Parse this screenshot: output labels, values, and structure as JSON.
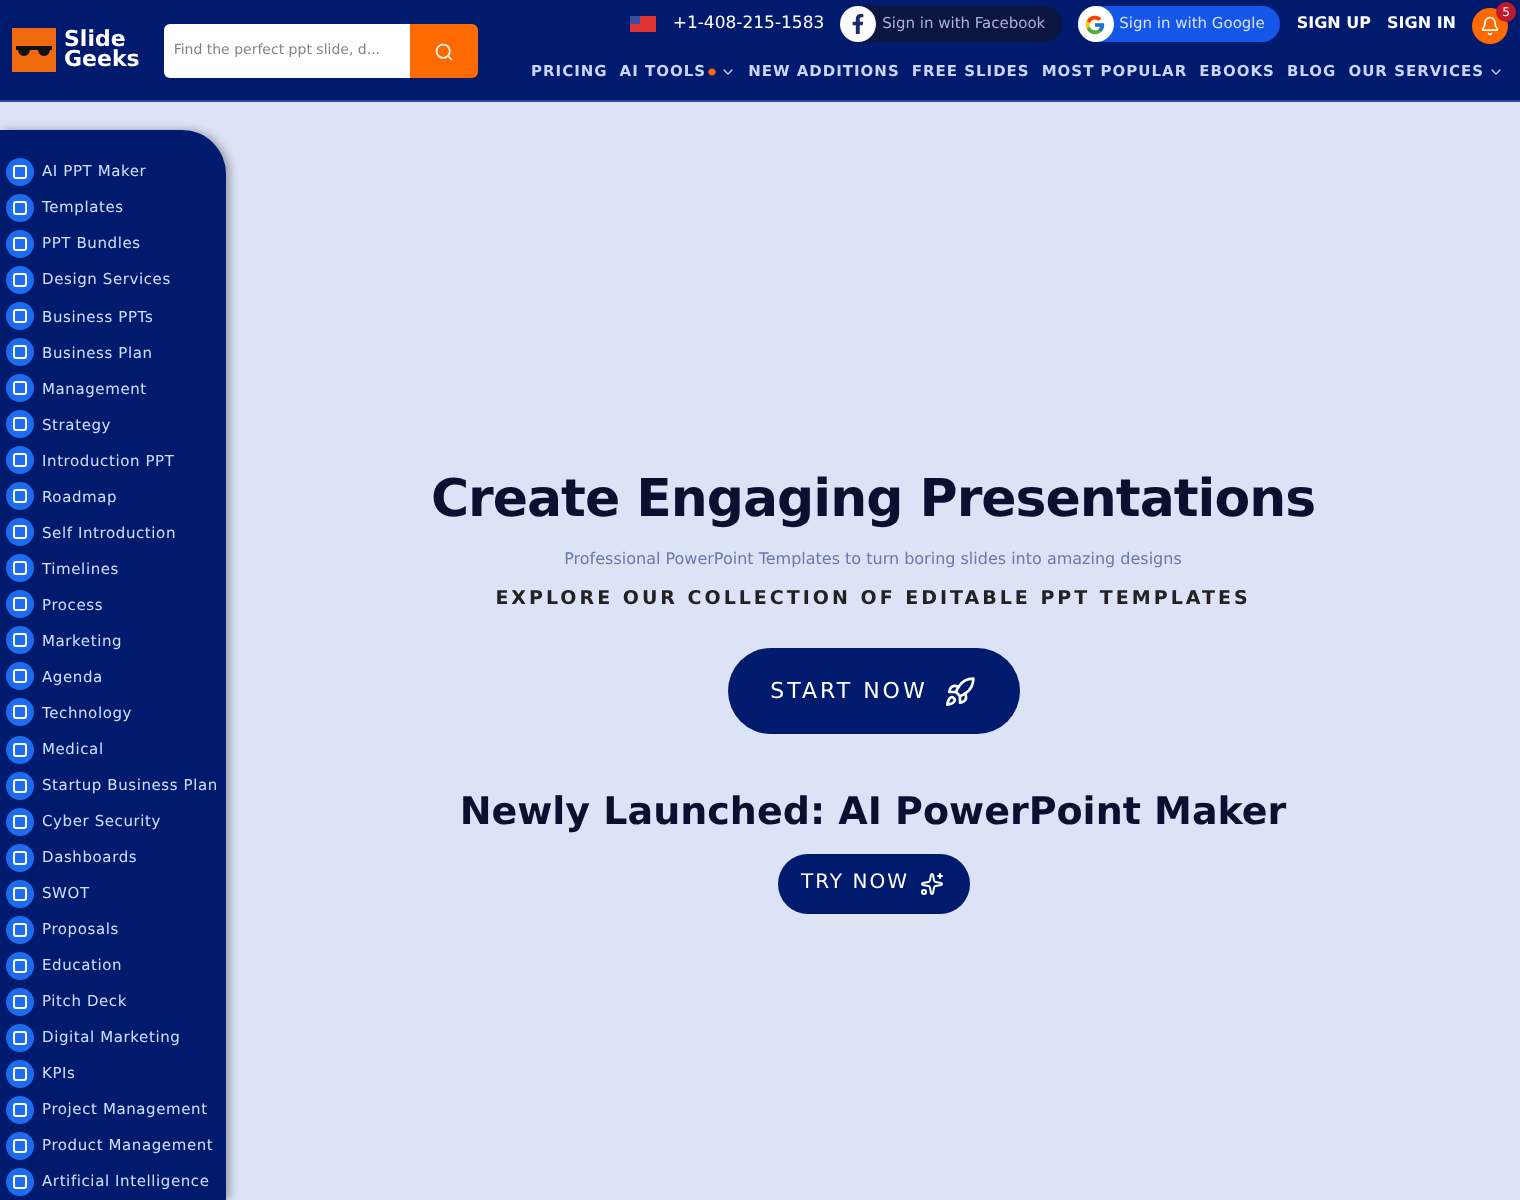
{
  "header": {
    "logo": {
      "line_1": "Slide",
      "line_2": "Geeks"
    },
    "search": {
      "placeholder": "Find the perfect ppt slide, d..."
    },
    "phone": "+1-408-215-1583",
    "facebook_button": "Sign in with Facebook",
    "google_button": "Sign in with Google",
    "sign_up": "SIGN UP",
    "sign_in": "SIGN IN",
    "notification_count": "5",
    "nav": [
      {
        "label": "PRICING",
        "dropdown": false,
        "dot": false
      },
      {
        "label": "AI TOOLS",
        "dropdown": true,
        "dot": true
      },
      {
        "label": "NEW ADDITIONS",
        "dropdown": false,
        "dot": false
      },
      {
        "label": "FREE SLIDES",
        "dropdown": false,
        "dot": false
      },
      {
        "label": "MOST POPULAR",
        "dropdown": false,
        "dot": false
      },
      {
        "label": "EBOOKS",
        "dropdown": false,
        "dot": false
      },
      {
        "label": "BLOG",
        "dropdown": false,
        "dot": false
      },
      {
        "label": "OUR SERVICES",
        "dropdown": true,
        "dot": false
      }
    ]
  },
  "sidebar": {
    "items": [
      "AI PPT Maker",
      "Templates",
      "PPT Bundles",
      "Design Services",
      "Business PPTs",
      "Business Plan",
      "Management",
      "Strategy",
      "Introduction PPT",
      "Roadmap",
      "Self Introduction",
      "Timelines",
      "Process",
      "Marketing",
      "Agenda",
      "Technology",
      "Medical",
      "Startup Business Plan",
      "Cyber Security",
      "Dashboards",
      "SWOT",
      "Proposals",
      "Education",
      "Pitch Deck",
      "Digital Marketing",
      "KPIs",
      "Project Management",
      "Product Management",
      "Artificial Intelligence"
    ]
  },
  "hero": {
    "title": "Create Engaging Presentations",
    "subtitle": "Professional PowerPoint Templates to turn boring slides into amazing designs",
    "tagline": "EXPLORE OUR COLLECTION OF EDITABLE PPT TEMPLATES",
    "start_button": "START NOW",
    "launch_title": "Newly Launched: AI PowerPoint Maker",
    "try_button": "TRY NOW"
  }
}
